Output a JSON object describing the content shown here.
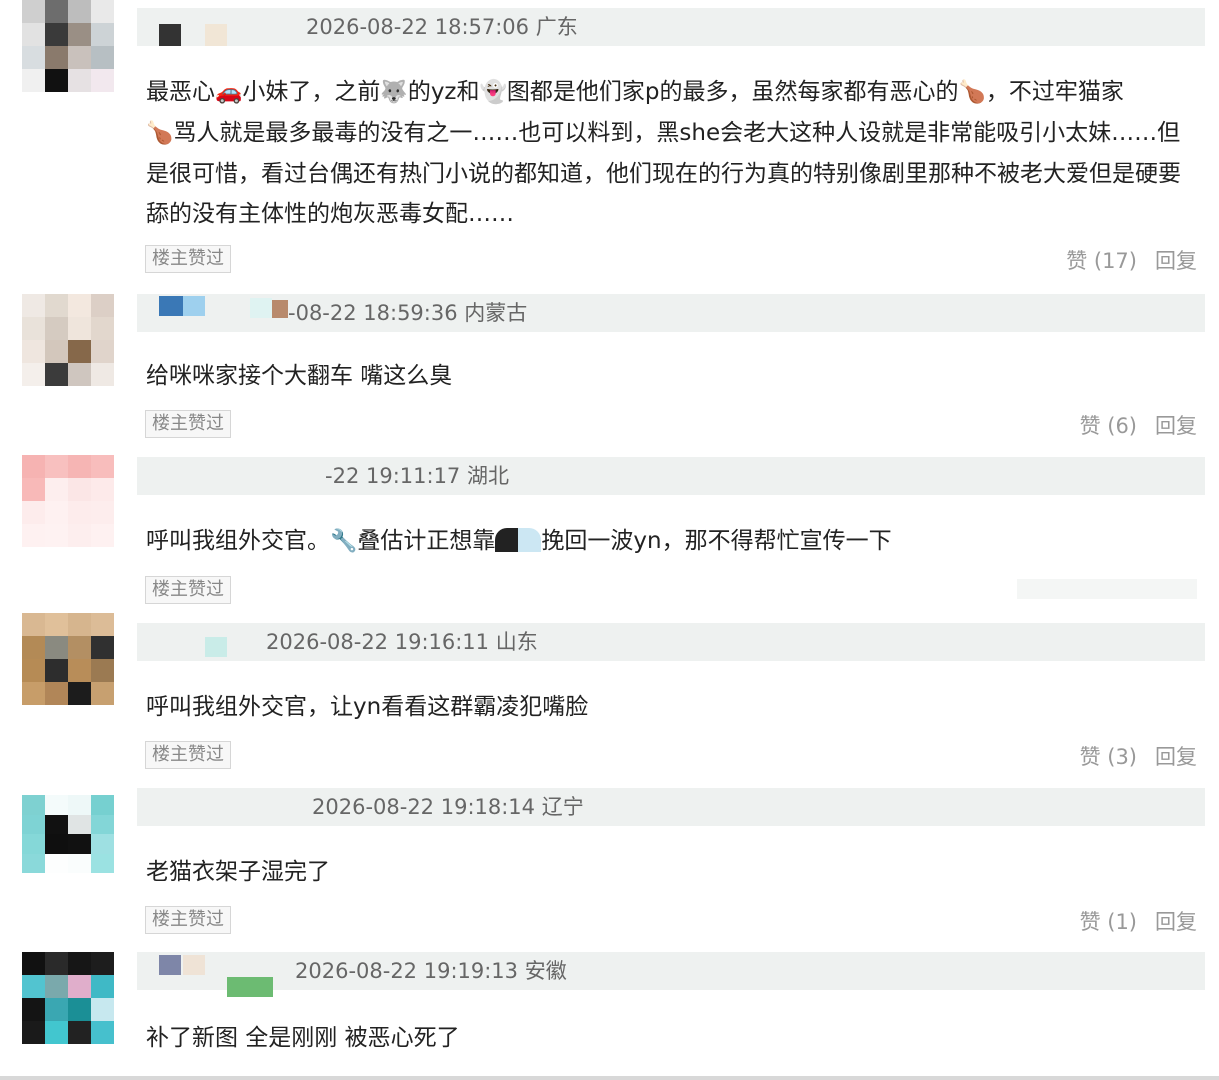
{
  "comments": [
    {
      "meta": "2026-08-22 18:57:06 广东",
      "content_parts": [
        "最恶心",
        "小妹了，之前",
        "的yz和",
        "图都是他们家p的最多，虽然每家都有恶心的",
        "，不过牢猫家",
        "骂人就是最多最毒的没有之一……也可以料到，黑she会老大这种人设就是非常能吸引小太妹……但是很可惜，看过台偶还有热门小说的都知道，他们现在的行为真的特别像剧里那种不被老大爱但是硬要舔的没有主体性的炮灰恶毒女配……"
      ],
      "emojis": [
        "car-emoji",
        "wolf-emoji",
        "ghost-emoji",
        "drumstick-emoji",
        "drumstick-emoji"
      ],
      "badge": "楼主赞过",
      "like": "赞 (17)",
      "reply": "回复"
    },
    {
      "meta": "-08-22 18:59:36 内蒙古",
      "content": "给咪咪家接个大翻车 嘴这么臭",
      "badge": "楼主赞过",
      "like": "赞 (6)",
      "reply": "回复"
    },
    {
      "meta": "-22 19:11:17 湖北",
      "content_parts": [
        "呼叫我组外交官。",
        "叠估计正想靠",
        "挽回一波yn，那不得帮忙宣传一下"
      ],
      "emojis": [
        "wrench-emoji"
      ],
      "badge": "楼主赞过",
      "like": "",
      "reply": ""
    },
    {
      "meta": "2026-08-22 19:16:11 山东",
      "content": "呼叫我组外交官，让yn看看这群霸凌犯嘴脸",
      "badge": "楼主赞过",
      "like": "赞 (3)",
      "reply": "回复"
    },
    {
      "meta": "2026-08-22 19:18:14 辽宁",
      "content": "老猫衣架子湿完了",
      "badge": "楼主赞过",
      "like": "赞 (1)",
      "reply": "回复"
    },
    {
      "meta": "2026-08-22 19:19:13 安徽",
      "content": "补了新图 全是刚刚 被恶心死了",
      "badge": "",
      "like": "",
      "reply": ""
    }
  ],
  "colors": {
    "meta_bar": "#eef1f0",
    "meta_text": "#666666",
    "content_text": "#222222",
    "action_text": "#999999"
  }
}
